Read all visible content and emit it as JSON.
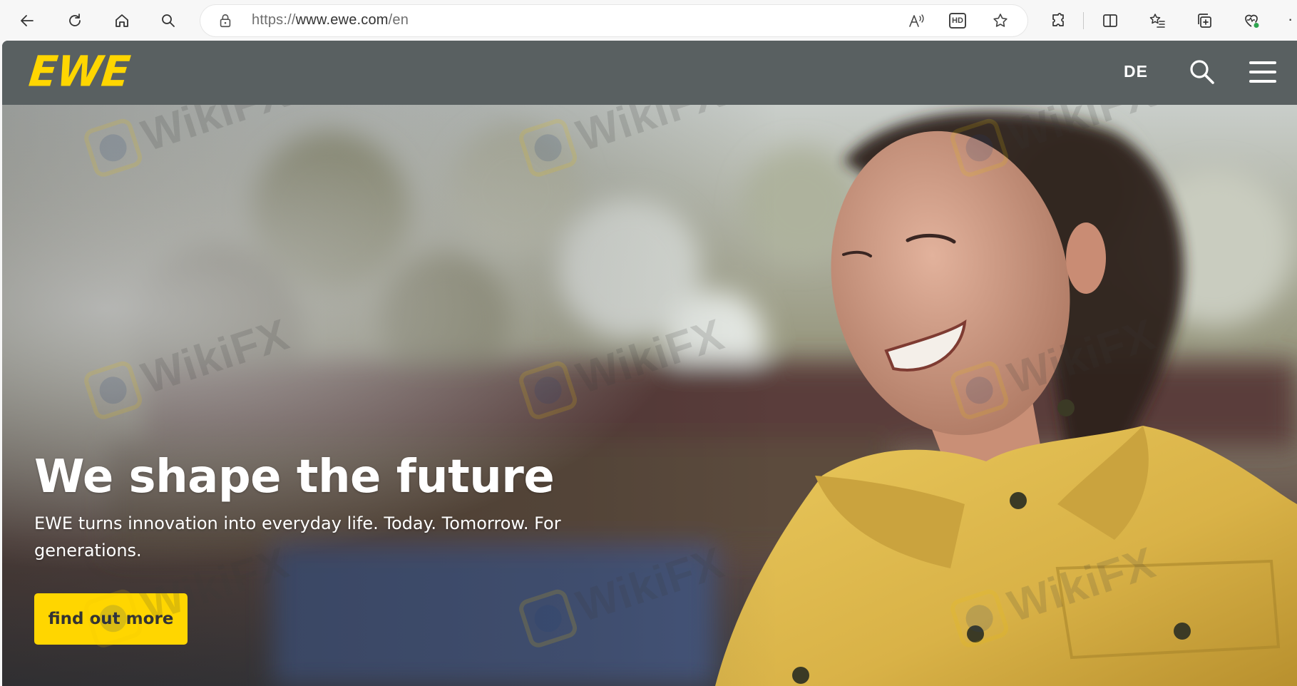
{
  "browser": {
    "url_scheme": "https://",
    "url_host": "www.ewe.com",
    "url_path": "/en",
    "hd_badge": "HD",
    "more_glyph": "·"
  },
  "site": {
    "logo_text": "EWE",
    "language_label": "DE",
    "brand_color": "#ffd600",
    "header_color": "#596061"
  },
  "hero": {
    "title": "We shape the future",
    "text": "EWE turns innovation into everyday life. Today. Tomorrow. For generations.",
    "cta_label": "find out more"
  },
  "watermark": {
    "text": "WikiFX"
  }
}
